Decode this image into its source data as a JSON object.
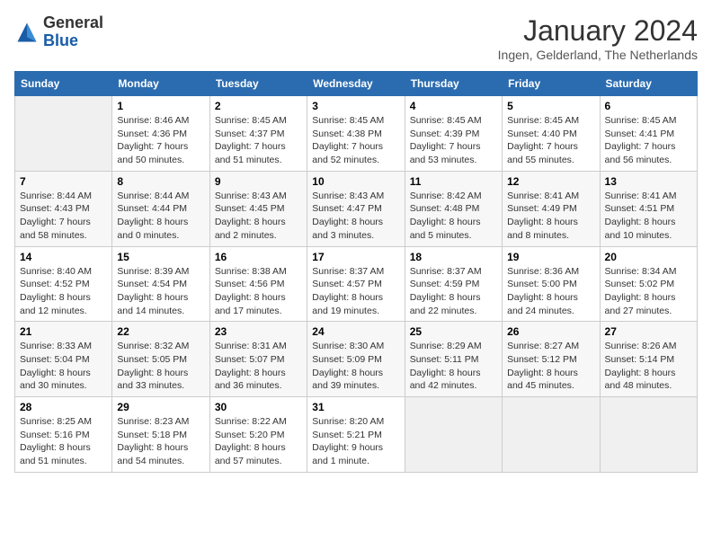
{
  "header": {
    "logo_general": "General",
    "logo_blue": "Blue",
    "month_title": "January 2024",
    "subtitle": "Ingen, Gelderland, The Netherlands"
  },
  "days_of_week": [
    "Sunday",
    "Monday",
    "Tuesday",
    "Wednesday",
    "Thursday",
    "Friday",
    "Saturday"
  ],
  "weeks": [
    [
      {
        "day": "",
        "empty": true
      },
      {
        "day": "1",
        "sunrise": "8:46 AM",
        "sunset": "4:36 PM",
        "daylight": "7 hours and 50 minutes."
      },
      {
        "day": "2",
        "sunrise": "8:45 AM",
        "sunset": "4:37 PM",
        "daylight": "7 hours and 51 minutes."
      },
      {
        "day": "3",
        "sunrise": "8:45 AM",
        "sunset": "4:38 PM",
        "daylight": "7 hours and 52 minutes."
      },
      {
        "day": "4",
        "sunrise": "8:45 AM",
        "sunset": "4:39 PM",
        "daylight": "7 hours and 53 minutes."
      },
      {
        "day": "5",
        "sunrise": "8:45 AM",
        "sunset": "4:40 PM",
        "daylight": "7 hours and 55 minutes."
      },
      {
        "day": "6",
        "sunrise": "8:45 AM",
        "sunset": "4:41 PM",
        "daylight": "7 hours and 56 minutes."
      }
    ],
    [
      {
        "day": "7",
        "sunrise": "8:44 AM",
        "sunset": "4:43 PM",
        "daylight": "7 hours and 58 minutes."
      },
      {
        "day": "8",
        "sunrise": "8:44 AM",
        "sunset": "4:44 PM",
        "daylight": "8 hours and 0 minutes."
      },
      {
        "day": "9",
        "sunrise": "8:43 AM",
        "sunset": "4:45 PM",
        "daylight": "8 hours and 2 minutes."
      },
      {
        "day": "10",
        "sunrise": "8:43 AM",
        "sunset": "4:47 PM",
        "daylight": "8 hours and 3 minutes."
      },
      {
        "day": "11",
        "sunrise": "8:42 AM",
        "sunset": "4:48 PM",
        "daylight": "8 hours and 5 minutes."
      },
      {
        "day": "12",
        "sunrise": "8:41 AM",
        "sunset": "4:49 PM",
        "daylight": "8 hours and 8 minutes."
      },
      {
        "day": "13",
        "sunrise": "8:41 AM",
        "sunset": "4:51 PM",
        "daylight": "8 hours and 10 minutes."
      }
    ],
    [
      {
        "day": "14",
        "sunrise": "8:40 AM",
        "sunset": "4:52 PM",
        "daylight": "8 hours and 12 minutes."
      },
      {
        "day": "15",
        "sunrise": "8:39 AM",
        "sunset": "4:54 PM",
        "daylight": "8 hours and 14 minutes."
      },
      {
        "day": "16",
        "sunrise": "8:38 AM",
        "sunset": "4:56 PM",
        "daylight": "8 hours and 17 minutes."
      },
      {
        "day": "17",
        "sunrise": "8:37 AM",
        "sunset": "4:57 PM",
        "daylight": "8 hours and 19 minutes."
      },
      {
        "day": "18",
        "sunrise": "8:37 AM",
        "sunset": "4:59 PM",
        "daylight": "8 hours and 22 minutes."
      },
      {
        "day": "19",
        "sunrise": "8:36 AM",
        "sunset": "5:00 PM",
        "daylight": "8 hours and 24 minutes."
      },
      {
        "day": "20",
        "sunrise": "8:34 AM",
        "sunset": "5:02 PM",
        "daylight": "8 hours and 27 minutes."
      }
    ],
    [
      {
        "day": "21",
        "sunrise": "8:33 AM",
        "sunset": "5:04 PM",
        "daylight": "8 hours and 30 minutes."
      },
      {
        "day": "22",
        "sunrise": "8:32 AM",
        "sunset": "5:05 PM",
        "daylight": "8 hours and 33 minutes."
      },
      {
        "day": "23",
        "sunrise": "8:31 AM",
        "sunset": "5:07 PM",
        "daylight": "8 hours and 36 minutes."
      },
      {
        "day": "24",
        "sunrise": "8:30 AM",
        "sunset": "5:09 PM",
        "daylight": "8 hours and 39 minutes."
      },
      {
        "day": "25",
        "sunrise": "8:29 AM",
        "sunset": "5:11 PM",
        "daylight": "8 hours and 42 minutes."
      },
      {
        "day": "26",
        "sunrise": "8:27 AM",
        "sunset": "5:12 PM",
        "daylight": "8 hours and 45 minutes."
      },
      {
        "day": "27",
        "sunrise": "8:26 AM",
        "sunset": "5:14 PM",
        "daylight": "8 hours and 48 minutes."
      }
    ],
    [
      {
        "day": "28",
        "sunrise": "8:25 AM",
        "sunset": "5:16 PM",
        "daylight": "8 hours and 51 minutes."
      },
      {
        "day": "29",
        "sunrise": "8:23 AM",
        "sunset": "5:18 PM",
        "daylight": "8 hours and 54 minutes."
      },
      {
        "day": "30",
        "sunrise": "8:22 AM",
        "sunset": "5:20 PM",
        "daylight": "8 hours and 57 minutes."
      },
      {
        "day": "31",
        "sunrise": "8:20 AM",
        "sunset": "5:21 PM",
        "daylight": "9 hours and 1 minute."
      },
      {
        "day": "",
        "empty": true
      },
      {
        "day": "",
        "empty": true
      },
      {
        "day": "",
        "empty": true
      }
    ]
  ],
  "labels": {
    "sunrise": "Sunrise:",
    "sunset": "Sunset:",
    "daylight": "Daylight:"
  },
  "colors": {
    "header_bg": "#2b6cb0",
    "header_text": "#ffffff"
  }
}
